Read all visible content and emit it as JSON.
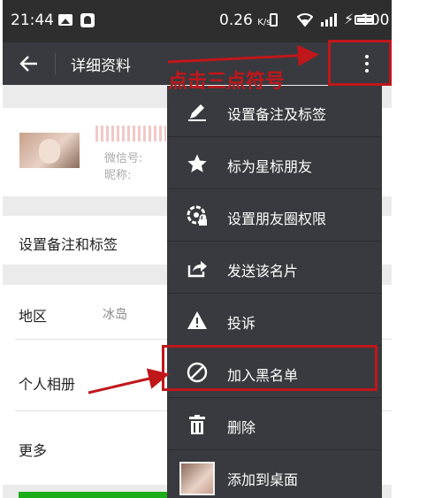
{
  "status_bar": {
    "time": "21:44",
    "speed": "0.26",
    "speed_unit": "K/s",
    "battery": "100"
  },
  "app_bar": {
    "title": "详细资料"
  },
  "annotations": {
    "top_caption": "点击三点符号"
  },
  "profile": {
    "wechat_id_label": "微信号:",
    "nickname_label": "昵称:"
  },
  "rows": {
    "remark_label": "设置备注和标签",
    "region_label": "地区",
    "region_value": "冰岛",
    "album_label": "个人相册",
    "more_label": "更多"
  },
  "menu": {
    "items": [
      {
        "label": "设置备注及标签",
        "icon": "pencil-icon"
      },
      {
        "label": "标为星标朋友",
        "icon": "star-icon"
      },
      {
        "label": "设置朋友圈权限",
        "icon": "moments-lock-icon"
      },
      {
        "label": "发送该名片",
        "icon": "share-icon"
      },
      {
        "label": "投诉",
        "icon": "warning-icon"
      },
      {
        "label": "加入黑名单",
        "icon": "block-icon"
      },
      {
        "label": "删除",
        "icon": "trash-icon"
      },
      {
        "label": "添加到桌面",
        "icon": "avatar-thumbnail"
      }
    ]
  },
  "colors": {
    "status_bar": "#2e2e2e",
    "app_bar": "#393a3f",
    "menu": "#393a3f",
    "annotation_red": "#c0171b",
    "wechat_green": "#1aad19"
  }
}
